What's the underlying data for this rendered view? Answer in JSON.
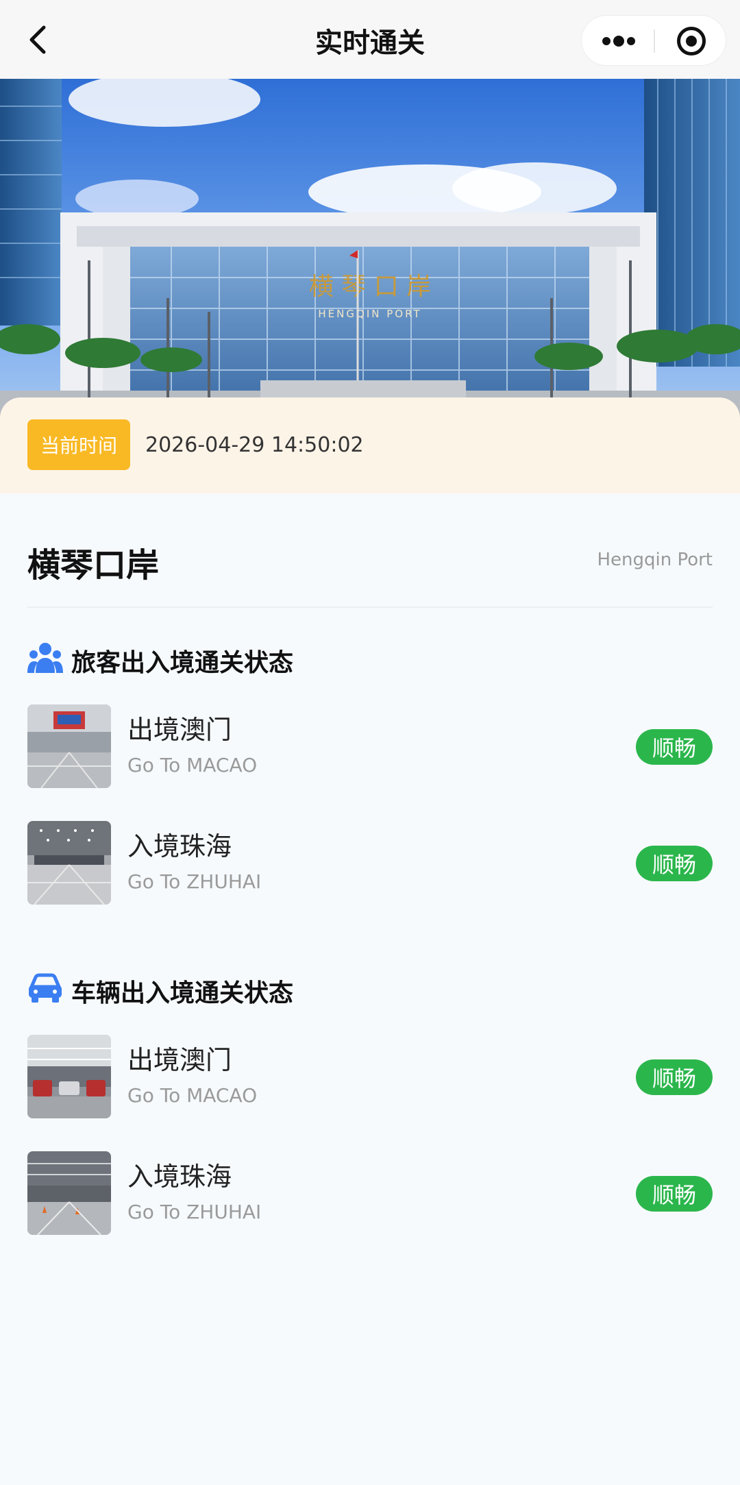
{
  "header": {
    "title": "实时通关"
  },
  "time": {
    "label": "当前时间",
    "value": "2026-04-29 14:50:02"
  },
  "hero": {
    "sign_cn": "横 琴 口 岸",
    "sign_en": "HENGQIN PORT"
  },
  "port": {
    "name": "横琴口岸",
    "name_en": "Hengqin Port"
  },
  "sections": [
    {
      "title": "旅客出入境通关状态",
      "icon": "people-icon",
      "items": [
        {
          "title": "出境澳门",
          "subtitle": "Go To MACAO",
          "status": "顺畅"
        },
        {
          "title": "入境珠海",
          "subtitle": "Go To ZHUHAI",
          "status": "顺畅"
        }
      ]
    },
    {
      "title": "车辆出入境通关状态",
      "icon": "car-icon",
      "items": [
        {
          "title": "出境澳门",
          "subtitle": "Go To MACAO",
          "status": "顺畅"
        },
        {
          "title": "入境珠海",
          "subtitle": "Go To ZHUHAI",
          "status": "顺畅"
        }
      ]
    }
  ],
  "colors": {
    "accent_orange": "#f9b925",
    "status_green": "#2bb64c",
    "icon_blue": "#3b7ef2",
    "time_bar_bg": "#fdf4e8"
  }
}
